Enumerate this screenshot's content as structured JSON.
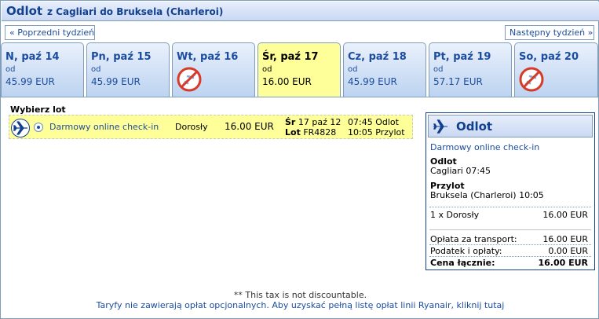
{
  "header": {
    "title": "Odlot",
    "route": "z Cagliari do Bruksela (Charleroi)"
  },
  "nav": {
    "prev_week": "« Poprzedni tydzień",
    "next_week": "Następny tydzień »"
  },
  "days": [
    {
      "label": "N, paź 14",
      "od": "od",
      "price": "45.99 EUR",
      "available": true,
      "selected": false
    },
    {
      "label": "Pn, paź 15",
      "od": "od",
      "price": "45.99 EUR",
      "available": true,
      "selected": false
    },
    {
      "label": "Wt, paź 16",
      "od": "",
      "price": "",
      "available": false,
      "selected": false
    },
    {
      "label": "Śr, paź 17",
      "od": "od",
      "price": "16.00 EUR",
      "available": true,
      "selected": true
    },
    {
      "label": "Cz, paź 18",
      "od": "od",
      "price": "45.99 EUR",
      "available": true,
      "selected": false
    },
    {
      "label": "Pt, paź 19",
      "od": "od",
      "price": "57.17 EUR",
      "available": true,
      "selected": false
    },
    {
      "label": "So, paź 20",
      "od": "",
      "price": "",
      "available": false,
      "selected": false
    }
  ],
  "flight_select": {
    "label": "Wybierz lot",
    "fare_name": "Darmowy online check-in",
    "passenger": "Dorosły",
    "price": "16.00 EUR",
    "day_prefix": "Śr",
    "date": "17 paź 12",
    "lot_label": "Lot",
    "flight_no": "FR4828",
    "dep_time": "07:45 Odlot",
    "arr_time": "10:05 Przylot",
    "selected": true
  },
  "summary": {
    "title": "Odlot",
    "fare_name": "Darmowy online check-in",
    "dep_label": "Odlot",
    "dep_value": "Cagliari 07:45",
    "arr_label": "Przylot",
    "arr_value": "Bruksela (Charleroi) 10:05",
    "pax_label": "1 x Dorosły",
    "pax_price": "16.00 EUR",
    "transport_label": "Opłata za transport:",
    "transport_value": "16.00 EUR",
    "tax_label": "Podatek i opłaty:",
    "tax_value": "0.00 EUR",
    "total_label": "Cena łącznie:",
    "total_value": "16.00 EUR"
  },
  "note": "** This tax is not discountable.",
  "footer": "Taryfy nie zawierają opłat opcjonalnych. Aby uzyskać pełną listę opłat linii Ryanair, kliknij tutaj",
  "colors": {
    "primary_blue": "#11408f",
    "link_blue": "#1b4c9e",
    "selected_yellow": "#ffff99",
    "border_blue": "#7f9db9"
  }
}
